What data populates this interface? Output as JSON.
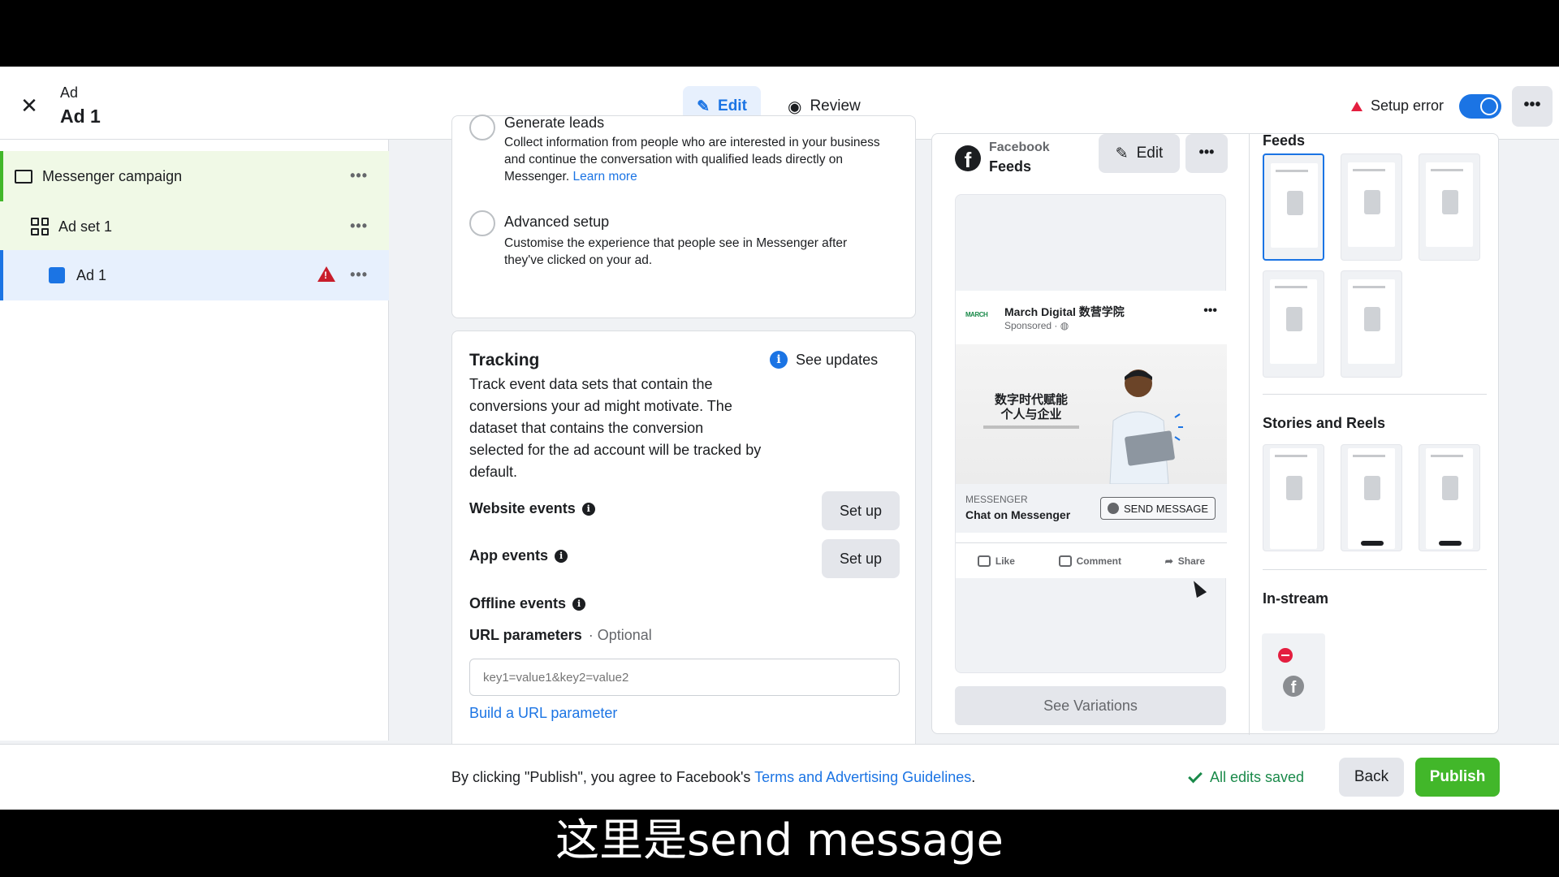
{
  "topbar": {
    "close_icon": "close-icon",
    "type_label": "Ad",
    "name": "Ad 1",
    "edit_label": "Edit",
    "review_label": "Review",
    "setup_error": "Setup error",
    "toggle_on": true,
    "more": "•••"
  },
  "tree": {
    "campaign": "Messenger campaign",
    "adset": "Ad set 1",
    "ad": "Ad 1",
    "more": "•••"
  },
  "options": {
    "generate_title": "Generate leads",
    "generate_desc": "Collect information from people who are interested in your business and continue the conversation with qualified leads directly on Messenger.",
    "learn_more": "Learn more",
    "advanced_title": "Advanced setup",
    "advanced_desc": "Customise the experience that people see in Messenger after they've clicked on your ad."
  },
  "tracking": {
    "title": "Tracking",
    "desc": "Track event data sets that contain the conversions your ad might motivate. The dataset that contains the conversion selected for the ad account will be tracked by default.",
    "see_updates": "See updates",
    "website_events": "Website events",
    "app_events": "App events",
    "offline_events": "Offline events",
    "setup_label": "Set up",
    "url_params_label": "URL parameters",
    "optional": "· Optional",
    "url_placeholder": "key1=value1&key2=value2",
    "build_link": "Build a URL parameter"
  },
  "preview": {
    "platform": "Facebook",
    "placement": "Feeds",
    "edit_label": "Edit",
    "more": "•••",
    "page_logo": "MARCH",
    "page_name": "March Digital 数营学院",
    "sponsored": "Sponsored · ",
    "headline_line1": "数字时代赋能",
    "headline_line2": "个人与企业",
    "cta_kicker": "MESSENGER",
    "cta_title": "Chat on Messenger",
    "cta_button": "SEND MESSAGE",
    "like": "Like",
    "comment": "Comment",
    "share": "Share",
    "see_variations": "See Variations"
  },
  "placements": {
    "feeds": "Feeds",
    "stories": "Stories and Reels",
    "instream": "In-stream"
  },
  "bottom": {
    "terms_prefix": "By clicking \"Publish\", you agree to Facebook's ",
    "terms_link": "Terms and Advertising Guidelines",
    "terms_suffix": ".",
    "saved": "All edits saved",
    "back": "Back",
    "publish": "Publish"
  },
  "subtitle": "这里是send message",
  "colors": {
    "accent": "#1b74e4",
    "publish": "#42b72a",
    "error": "#e41e3f",
    "selected_row": "#e7f0fd",
    "campaign_row": "#f0f9e6"
  }
}
